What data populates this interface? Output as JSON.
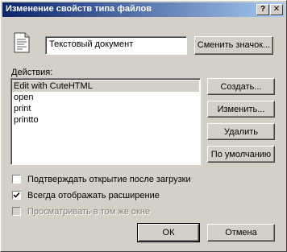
{
  "window": {
    "title": "Изменение свойств типа файлов",
    "help_glyph": "?",
    "close_glyph": "✕"
  },
  "file_type": {
    "icon": "text-document-icon",
    "description": "Текстовый документ",
    "change_icon_button": "Сменить значок..."
  },
  "actions": {
    "label": "Действия:",
    "items": [
      "Edit with CuteHTML",
      "open",
      "print",
      "printto"
    ],
    "selected_index": 0
  },
  "action_buttons": {
    "create": "Создать...",
    "edit": "Изменить...",
    "delete": "Удалить",
    "default": "По умолчанию"
  },
  "options": {
    "confirm_open": {
      "label": "Подтверждать открытие после загрузки",
      "checked": false,
      "enabled": true
    },
    "always_show_ext": {
      "label": "Всегда отображать расширение",
      "checked": true,
      "enabled": true
    },
    "browse_same_window": {
      "label": "Просматривать в том же окне",
      "checked": false,
      "enabled": false
    }
  },
  "footer": {
    "ok": "ОК",
    "cancel": "Отмена"
  }
}
